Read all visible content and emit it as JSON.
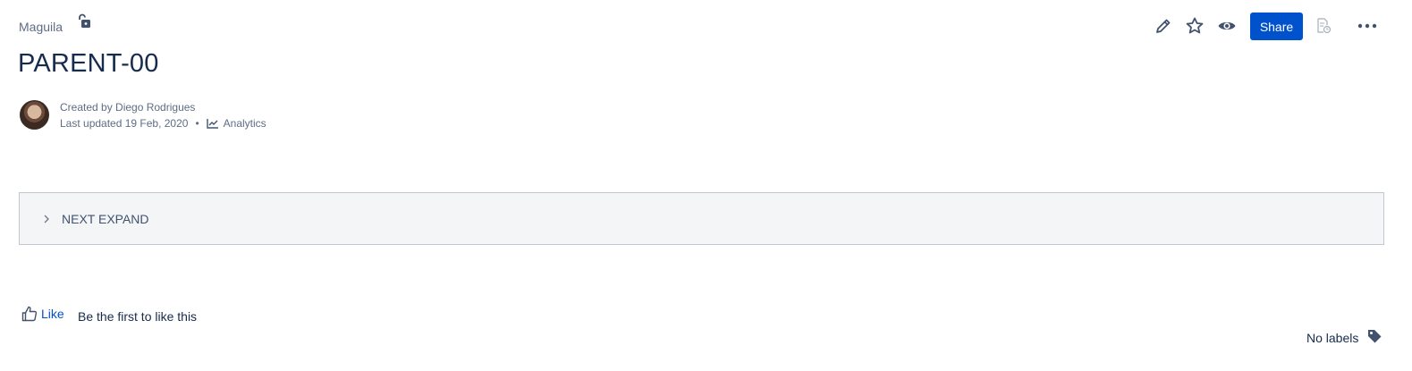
{
  "breadcrumb": {
    "space": "Maguila"
  },
  "toolbar": {
    "share_label": "Share",
    "icons": [
      "pencil-icon",
      "star-icon",
      "eye-icon",
      "page-history-icon",
      "more-icon"
    ]
  },
  "page": {
    "title": "PARENT-00"
  },
  "byline": {
    "created": "Created by Diego Rodrigues",
    "updated": "Last updated 19 Feb, 2020",
    "separator": "•",
    "analytics": "Analytics"
  },
  "expand": {
    "label": "NEXT EXPAND"
  },
  "footer": {
    "like_label": "Like",
    "like_hint": "Be the first to like this",
    "labels_text": "No labels"
  },
  "colors": {
    "primary": "#0052cc",
    "text": "#172b4d",
    "subtle": "#5e6c84",
    "expand_bg": "#f4f5f7"
  }
}
